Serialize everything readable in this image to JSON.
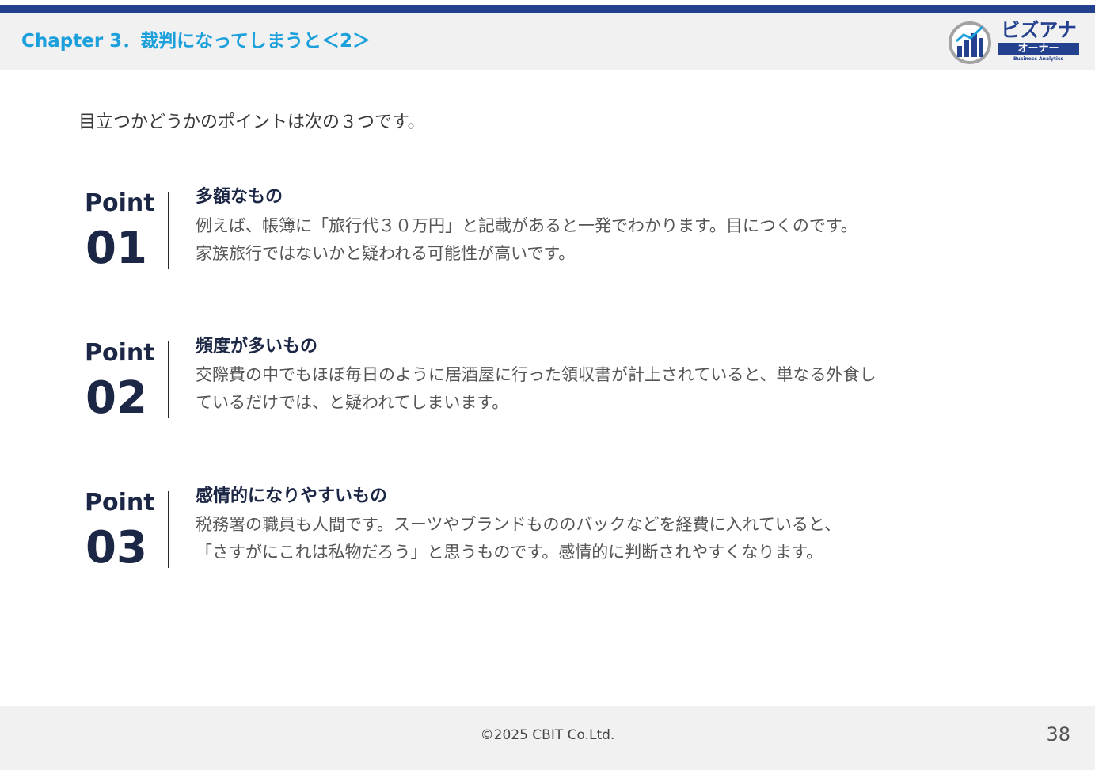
{
  "header": {
    "chapter_title": "Chapter 3．裁判になってしまうと＜2＞",
    "logo": {
      "name": "ビズアナ",
      "sub": "オーナー",
      "tagline": "Business Analytics",
      "brand_color": "#23418f"
    }
  },
  "intro": "目立つかどうかのポイントは次の３つです。",
  "points": [
    {
      "label": "Point",
      "number": "01",
      "heading": "多額なもの",
      "lines": [
        "例えば、帳簿に「旅行代３０万円」と記載があると一発でわかります。目につくのです。",
        "家族旅行ではないかと疑われる可能性が高いです。"
      ]
    },
    {
      "label": "Point",
      "number": "02",
      "heading": "頻度が多いもの",
      "lines": [
        "交際費の中でもほぼ毎日のように居酒屋に行った領収書が計上されていると、単なる外食し",
        "ているだけでは、と疑われてしまいます。"
      ]
    },
    {
      "label": "Point",
      "number": "03",
      "heading": "感情的になりやすいもの",
      "lines": [
        "税務署の職員も人間です。スーツやブランドもののバックなどを経費に入れていると、",
        "「さすがにこれは私物だろう」と思うものです。感情的に判断されやすくなります。"
      ]
    }
  ],
  "footer": {
    "copyright": "©2025 CBIT Co.Ltd.",
    "page_number": "38"
  },
  "colors": {
    "accent": "#1ca0dc",
    "navy": "#1c2645",
    "topbar": "#23418f"
  }
}
